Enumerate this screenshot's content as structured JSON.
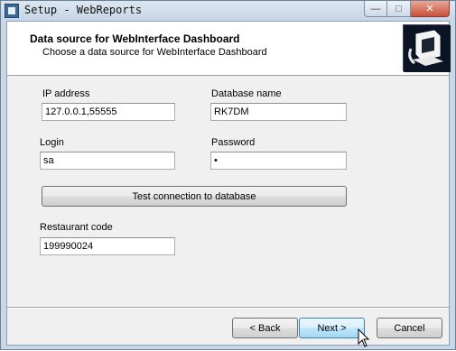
{
  "window": {
    "title": "Setup - WebReports",
    "minimize_symbol": "—",
    "maximize_symbol": "□",
    "close_symbol": "✕"
  },
  "header": {
    "title": "Data source for WebInterface Dashboard",
    "subtitle": "Choose a data source for WebInterface Dashboard"
  },
  "form": {
    "ip_label": "IP address",
    "ip_value": "127.0.0.1,55555",
    "db_label": "Database name",
    "db_value": "RK7DM",
    "login_label": "Login",
    "login_value": "sa",
    "password_label": "Password",
    "password_value": "•",
    "test_button": "Test connection to database",
    "restaurant_label": "Restaurant code",
    "restaurant_value": "199990024"
  },
  "buttons": {
    "back": "< Back",
    "next": "Next >",
    "cancel": "Cancel"
  },
  "icons": {
    "app": "setup-icon",
    "logo": "computer-box-icon",
    "cursor": "mouse-pointer-icon"
  }
}
